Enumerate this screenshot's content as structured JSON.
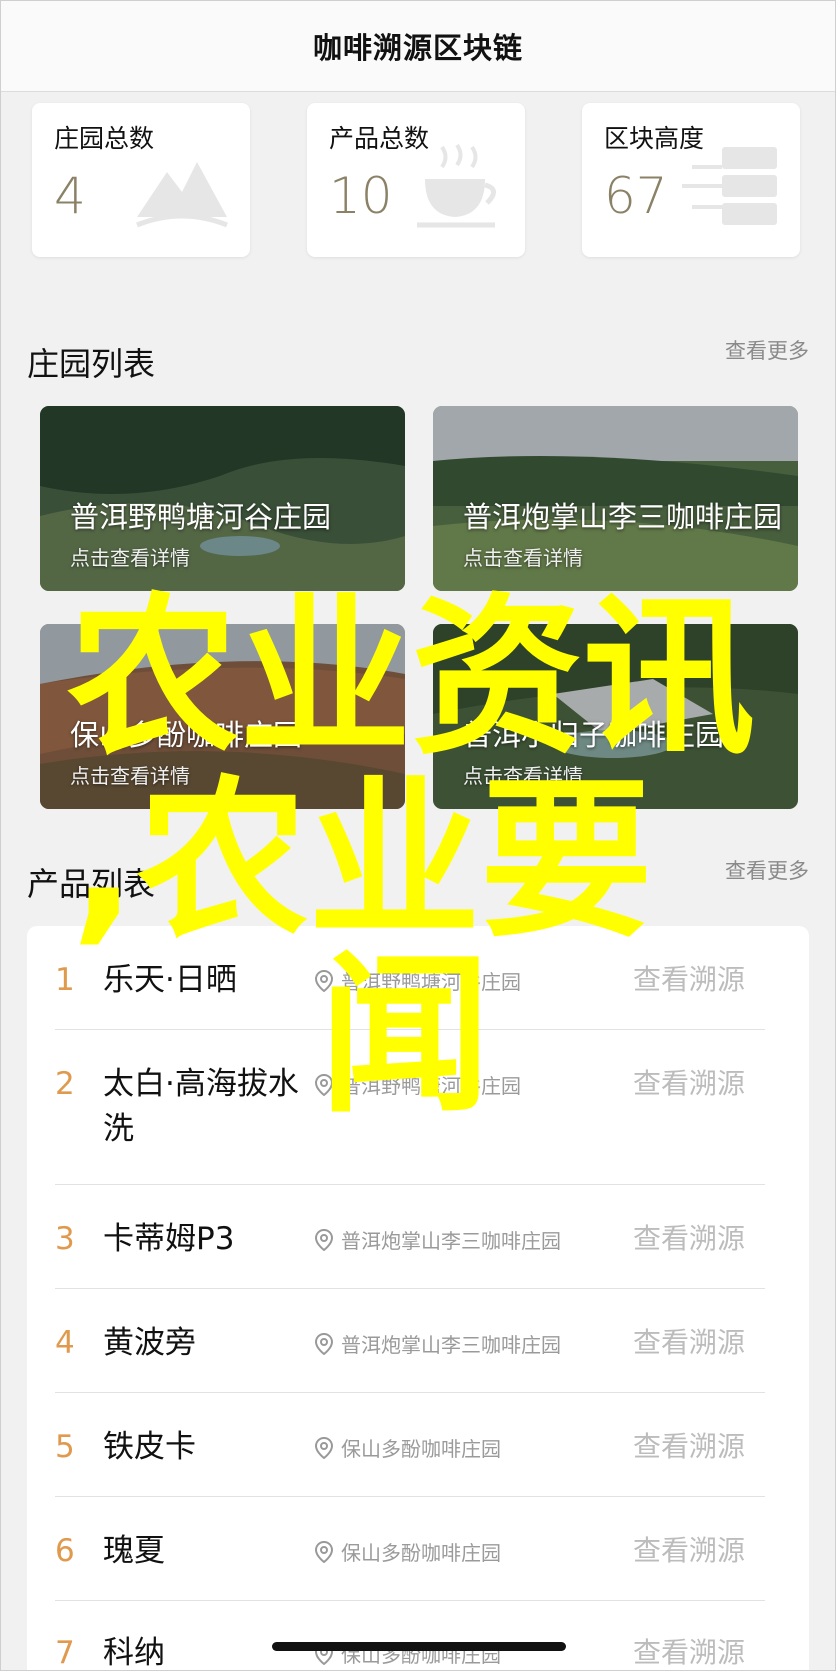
{
  "header": {
    "title": "咖啡溯源区块链"
  },
  "stats": [
    {
      "label": "庄园总数",
      "value": "4",
      "icon": "mountain-icon"
    },
    {
      "label": "产品总数",
      "value": "10",
      "icon": "coffee-cup-icon"
    },
    {
      "label": "区块高度",
      "value": "67",
      "icon": "server-icon"
    }
  ],
  "farm_section": {
    "title": "庄园列表",
    "more": "查看更多"
  },
  "farms": [
    {
      "name": "普洱野鸭塘河谷庄园",
      "hint": "点击查看详情"
    },
    {
      "name": "普洱炮掌山李三咖啡庄园",
      "hint": "点击查看详情"
    },
    {
      "name": "保山多酚咖啡庄园",
      "hint": "点击查看详情"
    },
    {
      "name": "普洱小归子咖啡庄园",
      "hint": "点击查看详情"
    }
  ],
  "product_section": {
    "title": "产品列表",
    "more": "查看更多"
  },
  "products": [
    {
      "index": "1",
      "name": "乐天·日晒",
      "farm": "普洱野鸭塘河谷庄园",
      "action": "查看溯源"
    },
    {
      "index": "2",
      "name": "太白·高海拔水洗",
      "farm": "普洱野鸭塘河谷庄园",
      "action": "查看溯源"
    },
    {
      "index": "3",
      "name": "卡蒂姆P3",
      "farm": "普洱炮掌山李三咖啡庄园",
      "action": "查看溯源"
    },
    {
      "index": "4",
      "name": "黄波旁",
      "farm": "普洱炮掌山李三咖啡庄园",
      "action": "查看溯源"
    },
    {
      "index": "5",
      "name": "铁皮卡",
      "farm": "保山多酚咖啡庄园",
      "action": "查看溯源"
    },
    {
      "index": "6",
      "name": "瑰夏",
      "farm": "保山多酚咖啡庄园",
      "action": "查看溯源"
    },
    {
      "index": "7",
      "name": "科纳",
      "farm": "保山多酚咖啡庄园",
      "action": "查看溯源"
    }
  ],
  "overlay": {
    "line1": "农业资讯",
    "line2": ",农业要",
    "line3": "闻"
  },
  "colors": {
    "accent": "#e09a4e",
    "overlay": "#ffff00",
    "stat_value": "#8a8166"
  }
}
